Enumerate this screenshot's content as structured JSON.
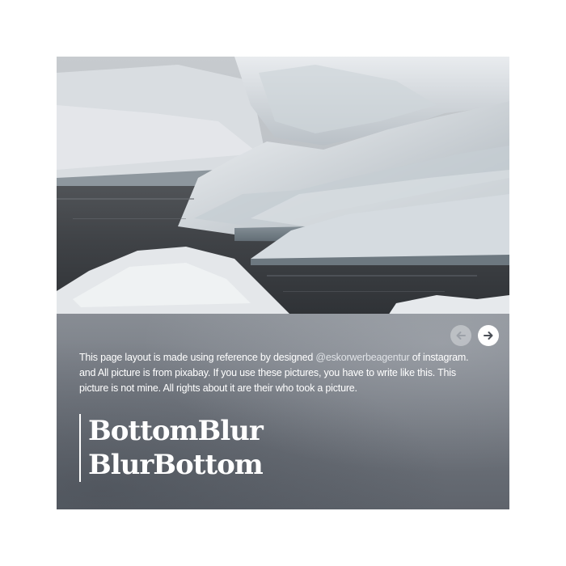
{
  "card": {
    "image_subject": "icebergs",
    "description_before": "This page layout is made using reference by designed ",
    "handle": "@eskorwerbeagentur",
    "description_after": " of instagram. and All picture is from pixabay. If you use these pictures, you have to write like this. This picture is not mine. All rights about it are their who took a picture.",
    "title_line_1": "BottomBlur",
    "title_line_2": "BlurBottom"
  },
  "nav": {
    "prev_icon": "arrow-left-icon",
    "next_icon": "arrow-right-icon"
  },
  "colors": {
    "panel": "#777c84",
    "text": "#ffffff",
    "handle": "#dfe2e6"
  }
}
